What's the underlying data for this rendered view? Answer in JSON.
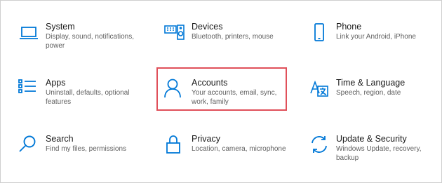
{
  "settings_tiles": [
    {
      "title": "System",
      "description": "Display, sound, notifications, power",
      "icon": "laptop-icon"
    },
    {
      "title": "Devices",
      "description": "Bluetooth, printers, mouse",
      "icon": "keyboard-speaker-icon"
    },
    {
      "title": "Phone",
      "description": "Link your Android, iPhone",
      "icon": "phone-icon"
    },
    {
      "title": "Apps",
      "description": "Uninstall, defaults, optional features",
      "icon": "apps-list-icon"
    },
    {
      "title": "Accounts",
      "description": "Your accounts, email, sync, work, family",
      "icon": "person-icon"
    },
    {
      "title": "Time & Language",
      "description": "Speech, region, date",
      "icon": "time-language-icon"
    },
    {
      "title": "Search",
      "description": "Find my files, permissions",
      "icon": "search-icon"
    },
    {
      "title": "Privacy",
      "description": "Location, camera, microphone",
      "icon": "lock-icon"
    },
    {
      "title": "Update & Security",
      "description": "Windows Update, recovery, backup",
      "icon": "sync-icon"
    }
  ],
  "colors": {
    "icon_accent": "#0078d7",
    "highlight_border": "#e0505a"
  }
}
